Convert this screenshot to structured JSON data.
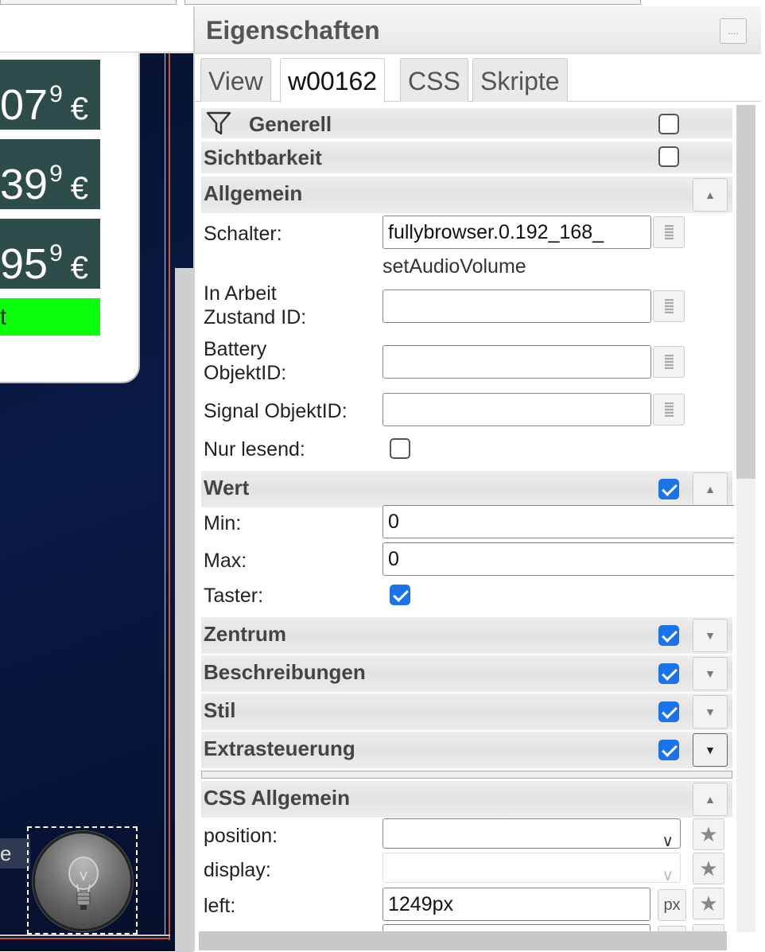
{
  "canvas": {
    "prices": [
      {
        "main": "07",
        "sup": "9",
        "currency": "€"
      },
      {
        "main": "39",
        "sup": "9",
        "currency": "€"
      },
      {
        "main": "95",
        "sup": "9",
        "currency": "€"
      }
    ],
    "green_button_text": "t",
    "partial_label": "e"
  },
  "panel": {
    "title": "Eigenschaften",
    "menu_icon": "....",
    "tabs": [
      {
        "label": "View"
      },
      {
        "label": "w00162"
      },
      {
        "label": "CSS"
      },
      {
        "label": "Skripte"
      }
    ],
    "active_tab": "w00162"
  },
  "groups": {
    "generell": "Generell",
    "sichtbarkeit": "Sichtbarkeit",
    "allgemein": "Allgemein",
    "wert": "Wert",
    "zentrum": "Zentrum",
    "beschreibungen": "Beschreibungen",
    "stil": "Stil",
    "extrasteuerung": "Extrasteuerung",
    "css_allgemein": "CSS Allgemein"
  },
  "fields": {
    "schalter_label": "Schalter:",
    "schalter_value": "fullybrowser.0.192_168_",
    "schalter_hint": "setAudioVolume",
    "in_arbeit_label_1": "In Arbeit",
    "in_arbeit_label_2": "Zustand ID:",
    "in_arbeit_value": "",
    "battery_label_1": "Battery",
    "battery_label_2": "ObjektID:",
    "battery_value": "",
    "signal_label": "Signal ObjektID:",
    "signal_value": "",
    "nur_lesend_label": "Nur lesend:",
    "min_label": "Min:",
    "min_value": "0",
    "max_label": "Max:",
    "max_value": "0",
    "taster_label": "Taster:",
    "position_label": "position:",
    "position_value": "",
    "display_label": "display:",
    "display_value": "",
    "left_label": "left:",
    "left_value": "1249px",
    "left_unit": "px"
  },
  "checks": {
    "generell": false,
    "sichtbarkeit": false,
    "nur_lesend": false,
    "wert": true,
    "taster": true,
    "zentrum": true,
    "beschreibungen": true,
    "stil": true,
    "extrasteuerung": true
  },
  "colors": {
    "accent": "#1a73e8",
    "price_bg": "#2e4d4a",
    "green_button": "#0aff0a",
    "canvas_bg": "#0a1a47"
  }
}
